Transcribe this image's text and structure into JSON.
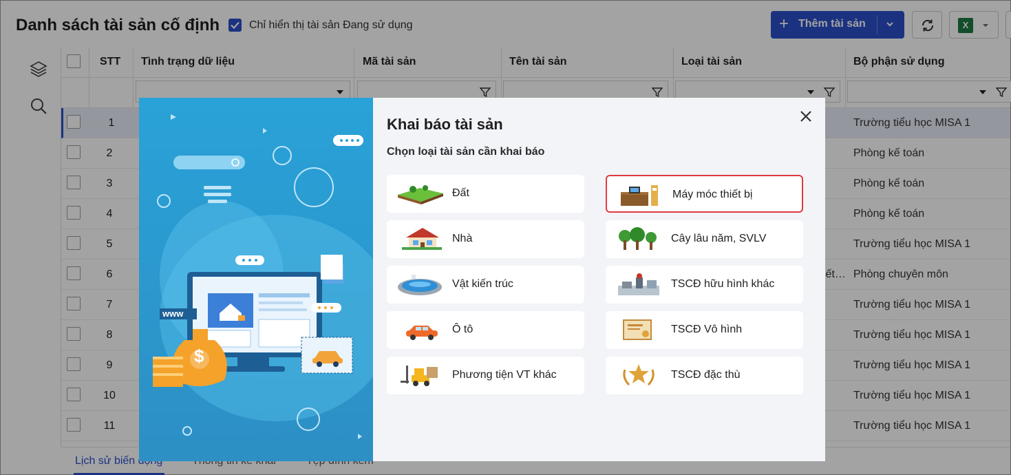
{
  "header": {
    "title": "Danh sách tài sản cố định",
    "filter_checkbox_label": "Chỉ hiển thị tài sản Đang sử dụng",
    "add_button_label": "Thêm tài sản",
    "excel_icon_text": "X"
  },
  "grid": {
    "columns": {
      "stt": "STT",
      "status": "Tình trạng dữ liệu",
      "code": "Mã tài sản",
      "name": "Tên tài sản",
      "type": "Loại tài sản",
      "department": "Bộ phận sử dụng"
    },
    "rows": [
      {
        "stt": "1",
        "department": "Trường tiểu học MISA 1"
      },
      {
        "stt": "2",
        "department": "Phòng kế toán"
      },
      {
        "stt": "3",
        "department": "Phòng kế toán"
      },
      {
        "stt": "4",
        "department": "Phòng kế toán"
      },
      {
        "stt": "5",
        "department": "Trường tiểu học MISA 1"
      },
      {
        "stt": "6",
        "department": "Phòng chuyên môn",
        "type_fragment": "iết…"
      },
      {
        "stt": "7",
        "department": "Trường tiểu học MISA 1"
      },
      {
        "stt": "8",
        "department": "Trường tiểu học MISA 1"
      },
      {
        "stt": "9",
        "department": "Trường tiểu học MISA 1"
      },
      {
        "stt": "10",
        "department": "Trường tiểu học MISA 1"
      },
      {
        "stt": "11",
        "department": "Trường tiểu học MISA 1"
      }
    ]
  },
  "bottom_tabs": [
    "Lịch sử biến động",
    "Thông tin kê khai",
    "Tệp đính kèm"
  ],
  "modal": {
    "title": "Khai báo tài sản",
    "subtitle": "Chọn loại tài sản cần khai báo",
    "art_text": "www",
    "options": [
      {
        "label": "Đất",
        "icon": "land-icon"
      },
      {
        "label": "Máy móc thiết bị",
        "icon": "machinery-icon",
        "selected": true
      },
      {
        "label": "Nhà",
        "icon": "house-icon"
      },
      {
        "label": "Cây lâu năm, SVLV",
        "icon": "trees-icon"
      },
      {
        "label": "Vật kiến trúc",
        "icon": "structure-icon"
      },
      {
        "label": "TSCĐ hữu hình khác",
        "icon": "other-tangible-icon"
      },
      {
        "label": "Ô tô",
        "icon": "car-icon"
      },
      {
        "label": "TSCĐ Vô hình",
        "icon": "intangible-icon"
      },
      {
        "label": "Phương tiện VT khác",
        "icon": "forklift-icon"
      },
      {
        "label": "TSCĐ đặc thù",
        "icon": "special-asset-icon"
      }
    ]
  },
  "colors": {
    "primary": "#2b4fc9",
    "highlight_border": "#e0393e",
    "art_background": "#29a2d8"
  }
}
